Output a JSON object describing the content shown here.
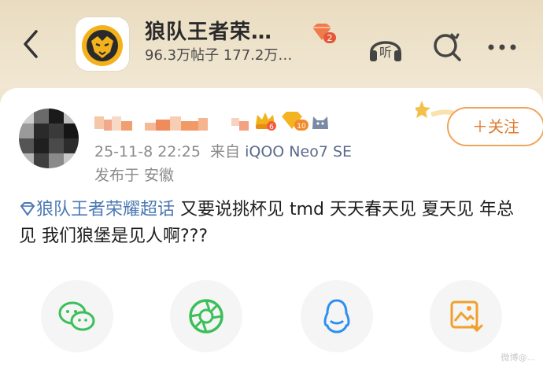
{
  "header": {
    "title": "狼队王者荣…",
    "stats": "96.3万帖子 177.2万…",
    "level_badge": "2"
  },
  "post": {
    "meta_time": "25-11-8 22:25",
    "meta_from": "来自",
    "meta_device": "iQOO Neo7 SE",
    "location": "发布于 安徽",
    "follow_label": "＋关注",
    "topic": "狼队王者荣耀超话",
    "body_text": " 又要说挑杯见 tmd 天天春天见 夏天见 年总见 我们狼堡是见人啊???",
    "badges": [
      "6",
      "10"
    ]
  },
  "share": [
    {
      "name": "wechat"
    },
    {
      "name": "moments"
    },
    {
      "name": "qq"
    },
    {
      "name": "save-image"
    }
  ],
  "watermark": "微博@..."
}
